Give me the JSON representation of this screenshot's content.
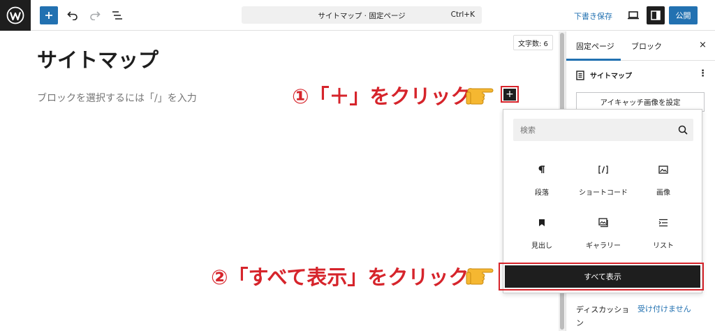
{
  "topbar": {
    "document_title": "サイトマップ · 固定ページ",
    "shortcut": "Ctrl+K",
    "draft_label": "下書き保存",
    "publish_label": "公開"
  },
  "editor": {
    "title": "サイトマップ",
    "placeholder": "ブロックを選択するには「/」を入力",
    "word_count": "文字数: 6",
    "inline_add_symbol": "+"
  },
  "annotations": {
    "step1": "①「＋」をクリック",
    "step2": "②「すべて表示」をクリック"
  },
  "sidebar": {
    "tabs": [
      {
        "label": "固定ページ",
        "active": true
      },
      {
        "label": "ブロック",
        "active": false
      }
    ],
    "close_symbol": "×",
    "doc_title": "サイトマップ",
    "more_symbol": "⋮",
    "featured_image_button": "アイキャッチ画像を設定",
    "discussion_label": "ディスカッション",
    "discussion_value": "受け付けません"
  },
  "inserter": {
    "search_placeholder": "検索",
    "blocks": [
      {
        "label": "段落",
        "icon": "paragraph-icon"
      },
      {
        "label": "ショートコード",
        "icon": "shortcode-icon"
      },
      {
        "label": "画像",
        "icon": "image-icon"
      },
      {
        "label": "見出し",
        "icon": "heading-icon"
      },
      {
        "label": "ギャラリー",
        "icon": "gallery-icon"
      },
      {
        "label": "リスト",
        "icon": "list-icon"
      }
    ],
    "show_all_label": "すべて表示"
  },
  "colors": {
    "accent": "#2271b1",
    "annotation": "#d6242b",
    "dark": "#1e1e1e"
  }
}
